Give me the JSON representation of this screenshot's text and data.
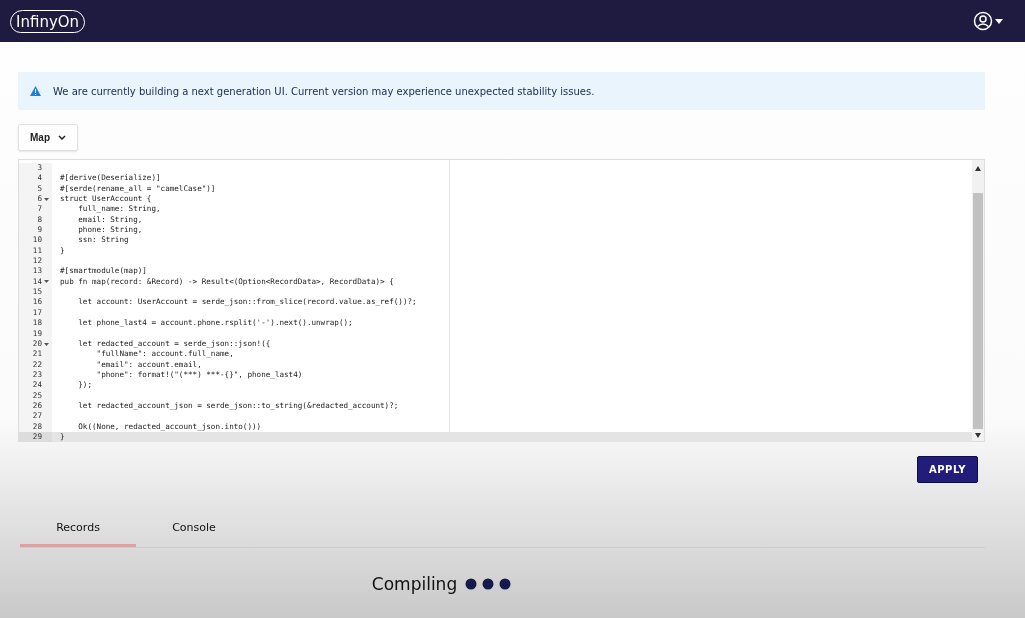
{
  "header": {
    "logo": "InfinyOn"
  },
  "banner": {
    "message": "We are currently building a next generation UI. Current version may experience unexpected stability issues."
  },
  "mode_dropdown": {
    "value": "Map"
  },
  "editor": {
    "lines": [
      {
        "number": "3",
        "fold": false,
        "active": false
      },
      {
        "number": "4",
        "text": "#[derive(Deserialize)]",
        "fold": false,
        "active": false
      },
      {
        "number": "5",
        "text": "#[serde(rename_all = \"camelCase\")]",
        "fold": false,
        "active": false
      },
      {
        "number": "6",
        "text": "struct UserAccount {",
        "fold": true,
        "active": false
      },
      {
        "number": "7",
        "text": "    full_name: String,",
        "fold": false,
        "active": false
      },
      {
        "number": "8",
        "text": "    email: String,",
        "fold": false,
        "active": false
      },
      {
        "number": "9",
        "text": "    phone: String,",
        "fold": false,
        "active": false
      },
      {
        "number": "10",
        "text": "    ssn: String",
        "fold": false,
        "active": false
      },
      {
        "number": "11",
        "text": "}",
        "fold": false,
        "active": false
      },
      {
        "number": "12",
        "fold": false,
        "active": false
      },
      {
        "number": "13",
        "text": "#[smartmodule(map)]",
        "fold": false,
        "active": false
      },
      {
        "number": "14",
        "text": "pub fn map(record: &Record) -> Result<(Option<RecordData>, RecordData)> {",
        "fold": true,
        "active": false
      },
      {
        "number": "15",
        "fold": false,
        "active": false
      },
      {
        "number": "16",
        "text": "    let account: UserAccount = serde_json::from_slice(record.value.as_ref())?;",
        "fold": false,
        "active": false
      },
      {
        "number": "17",
        "fold": false,
        "active": false
      },
      {
        "number": "18",
        "text": "    let phone_last4 = account.phone.rsplit('-').next().unwrap();",
        "fold": false,
        "active": false
      },
      {
        "number": "19",
        "fold": false,
        "active": false
      },
      {
        "number": "20",
        "text": "    let redacted_account = serde_json::json!({",
        "fold": true,
        "active": false
      },
      {
        "number": "21",
        "text": "        \"fullName\": account.full_name,",
        "fold": false,
        "active": false
      },
      {
        "number": "22",
        "text": "        \"email\": account.email,",
        "fold": false,
        "active": false
      },
      {
        "number": "23",
        "text": "        \"phone\": format!(\"(***) ***-{}\", phone_last4)",
        "fold": false,
        "active": false
      },
      {
        "number": "24",
        "text": "    });",
        "fold": false,
        "active": false
      },
      {
        "number": "25",
        "fold": false,
        "active": false
      },
      {
        "number": "26",
        "text": "    let redacted_account_json = serde_json::to_string(&redacted_account)?;",
        "fold": false,
        "active": false
      },
      {
        "number": "27",
        "fold": false,
        "active": false
      },
      {
        "number": "28",
        "text": "    Ok((None, redacted_account_json.into()))",
        "fold": false,
        "active": false
      },
      {
        "number": "29",
        "text": "}",
        "fold": false,
        "active": true
      }
    ]
  },
  "apply_button": {
    "label": "APPLY"
  },
  "tabs": [
    {
      "label": "Records",
      "selected": true
    },
    {
      "label": "Console",
      "selected": false
    }
  ],
  "status": {
    "text": "Compiling"
  }
}
